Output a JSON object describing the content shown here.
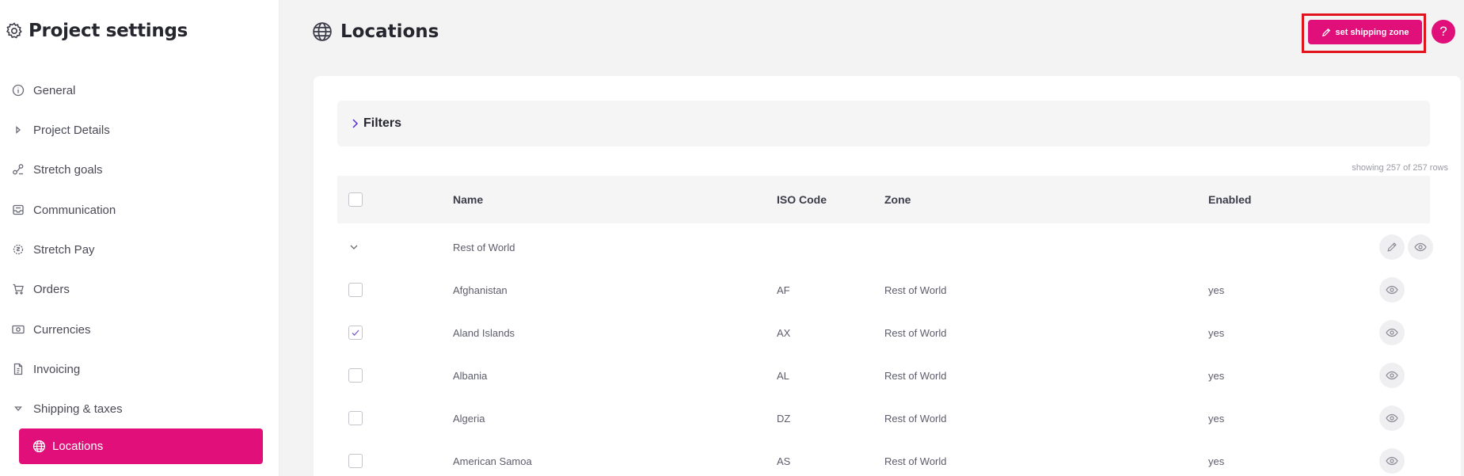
{
  "sidebar": {
    "title": "Project settings",
    "items": [
      {
        "label": "General",
        "icon": "info-icon"
      },
      {
        "label": "Project Details",
        "icon": "caret-right-icon"
      },
      {
        "label": "Stretch goals",
        "icon": "stretch-goals-icon"
      },
      {
        "label": "Communication",
        "icon": "inbox-icon"
      },
      {
        "label": "Stretch Pay",
        "icon": "stretch-pay-icon"
      },
      {
        "label": "Orders",
        "icon": "cart-icon"
      },
      {
        "label": "Currencies",
        "icon": "banknote-icon"
      },
      {
        "label": "Invoicing",
        "icon": "invoice-icon"
      },
      {
        "label": "Shipping & taxes",
        "icon": "caret-down-icon"
      }
    ],
    "active_item": {
      "label": "Locations",
      "icon": "globe-icon"
    }
  },
  "header": {
    "title": "Locations",
    "set_zone_label": "set shipping zone",
    "help_label": "?"
  },
  "filters": {
    "label": "Filters"
  },
  "table": {
    "rows_count": "showing 257 of 257 rows",
    "columns": {
      "name": "Name",
      "iso": "ISO Code",
      "zone": "Zone",
      "enabled": "Enabled"
    },
    "group": {
      "name": "Rest of World"
    },
    "rows": [
      {
        "name": "Afghanistan",
        "iso": "AF",
        "zone": "Rest of World",
        "enabled": "yes",
        "checked": false
      },
      {
        "name": "Aland Islands",
        "iso": "AX",
        "zone": "Rest of World",
        "enabled": "yes",
        "checked": true
      },
      {
        "name": "Albania",
        "iso": "AL",
        "zone": "Rest of World",
        "enabled": "yes",
        "checked": false
      },
      {
        "name": "Algeria",
        "iso": "DZ",
        "zone": "Rest of World",
        "enabled": "yes",
        "checked": false
      },
      {
        "name": "American Samoa",
        "iso": "AS",
        "zone": "Rest of World",
        "enabled": "yes",
        "checked": false
      }
    ]
  },
  "colors": {
    "accent": "#e00f7a",
    "highlight_border": "#e1141e",
    "sidebar_bg": "#ffffff",
    "page_bg": "#f3f3f4"
  }
}
